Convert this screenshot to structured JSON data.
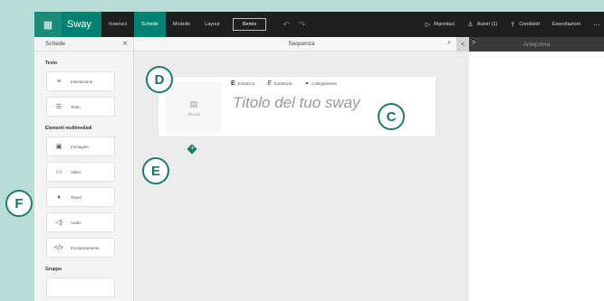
{
  "topbar": {
    "brand": "Sway",
    "menu": [
      "Inserisci",
      "Schede",
      "Modello",
      "Layout"
    ],
    "active_menu": "Schede",
    "remix": "Remix",
    "actions": [
      {
        "icon": "play-icon",
        "glyph": "▷",
        "label": "Riproduci"
      },
      {
        "icon": "authors-icon",
        "glyph": "♙",
        "label": "Autori (1)"
      },
      {
        "icon": "share-icon",
        "glyph": "⇪",
        "label": "Condividi"
      },
      {
        "icon": "",
        "glyph": "",
        "label": "Esercitazioni"
      }
    ],
    "more": "···"
  },
  "left": {
    "header": "Schede",
    "sections": [
      {
        "title": "Testo",
        "items": [
          {
            "icon": "≡",
            "label": "Intestazione"
          },
          {
            "icon": "☰",
            "label": "Testo"
          }
        ]
      },
      {
        "title": "Elementi multimediali",
        "items": [
          {
            "icon": "▣",
            "label": "Immagine"
          },
          {
            "icon": "▭",
            "label": "Video"
          },
          {
            "icon": "♦",
            "label": "Tweet"
          },
          {
            "icon": "◁)",
            "label": "Audio"
          },
          {
            "icon": "</>",
            "label": "Incorporamento"
          }
        ]
      },
      {
        "title": "Gruppo",
        "items": []
      }
    ]
  },
  "center": {
    "header": "Sequenza",
    "bg_label": "Sfondo",
    "format_buttons": [
      {
        "glyph": "E",
        "label": "Enfatizza"
      },
      {
        "glyph": "E",
        "label": "Evidenzia"
      },
      {
        "glyph": "⚭",
        "label": "Collegamento"
      }
    ],
    "title_placeholder": "Titolo del tuo sway",
    "plus": "+"
  },
  "right": {
    "header": "Anteprima",
    "arrow": ">"
  },
  "collapse_arrow": "<",
  "callouts": [
    "D",
    "C",
    "E",
    "F"
  ]
}
